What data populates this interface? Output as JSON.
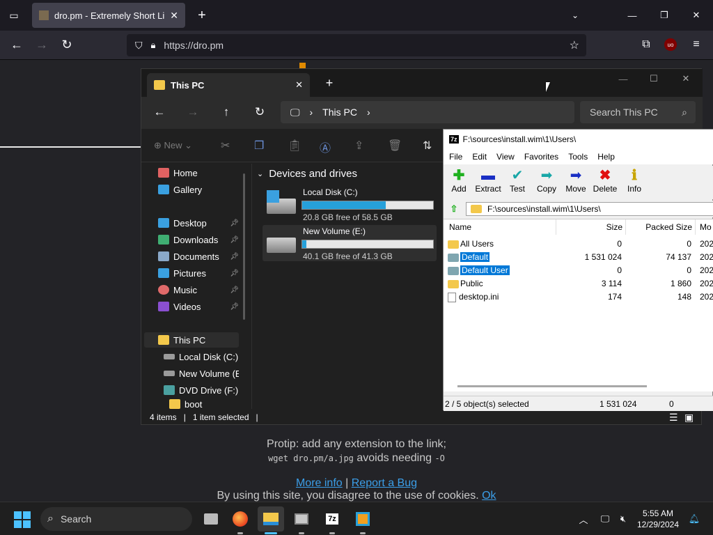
{
  "browser": {
    "tab_title": "dro.pm - Extremely Short Links",
    "url": "https://dro.pm"
  },
  "explorer": {
    "tab_title": "This PC",
    "breadcrumb": "This PC",
    "search_placeholder": "Search This PC",
    "new_label": "New",
    "nav": {
      "home": "Home",
      "gallery": "Gallery",
      "desktop": "Desktop",
      "downloads": "Downloads",
      "documents": "Documents",
      "pictures": "Pictures",
      "music": "Music",
      "videos": "Videos",
      "this_pc": "This PC",
      "local_disk": "Local Disk (C:)",
      "new_volume": "New Volume (E:",
      "dvd": "DVD Drive (F:) S",
      "boot": "boot"
    },
    "section_title": "Devices and drives",
    "drives": [
      {
        "name": "Local Disk (C:)",
        "free": "20.8 GB free of 58.5 GB",
        "used_fraction": 0.64
      },
      {
        "name": "New Volume (E:)",
        "free": "40.1 GB free of 41.3 GB",
        "used_fraction": 0.03
      }
    ],
    "status_items": "4 items",
    "status_selected": "1 item selected"
  },
  "zip": {
    "title": "F:\\sources\\install.wim\\1\\Users\\",
    "menu": [
      "File",
      "Edit",
      "View",
      "Favorites",
      "Tools",
      "Help"
    ],
    "toolbar": [
      "Add",
      "Extract",
      "Test",
      "Copy",
      "Move",
      "Delete",
      "Info"
    ],
    "path": "F:\\sources\\install.wim\\1\\Users\\",
    "columns": [
      "Name",
      "Size",
      "Packed Size",
      "Mo"
    ],
    "rows": [
      {
        "name": "All Users",
        "size": "0",
        "packed": "0",
        "mod": "202"
      },
      {
        "name": "Default",
        "size": "1 531 024",
        "packed": "74 137",
        "mod": "202"
      },
      {
        "name": "Default User",
        "size": "0",
        "packed": "0",
        "mod": "202"
      },
      {
        "name": "Public",
        "size": "3 114",
        "packed": "1 860",
        "mod": "202"
      },
      {
        "name": "desktop.ini",
        "size": "174",
        "packed": "148",
        "mod": "202"
      }
    ],
    "status_selected": "2 / 5 object(s) selected",
    "status_size": "1 531 024",
    "status_packed": "0"
  },
  "page": {
    "protip_line1": "Protip: add any extension to the link;",
    "protip_code1": "wget dro.pm/a.jpg",
    "protip_mid": "avoids needing",
    "protip_code2": "-O",
    "more_info": "More info",
    "separator": "|",
    "report_bug": "Report a Bug",
    "cookie_text": "By using this site, you disagree to the use of cookies.",
    "cookie_ok": "Ok"
  },
  "taskbar": {
    "search": "Search",
    "time": "5:55 AM",
    "date": "12/29/2024"
  },
  "colors": {
    "accent": "#0078d7",
    "drive_bar": "#26a0da",
    "link": "#3b9ee8"
  }
}
